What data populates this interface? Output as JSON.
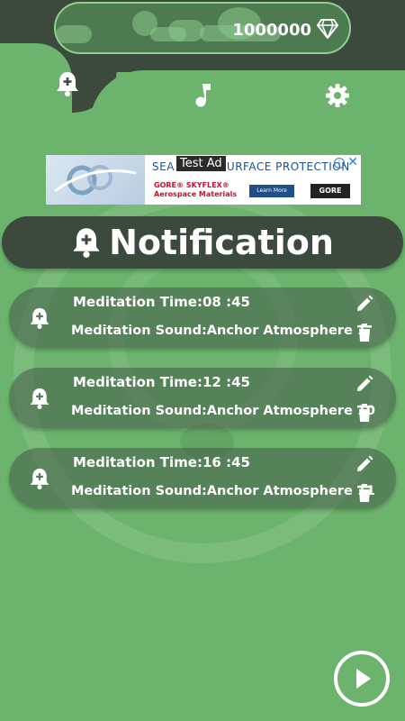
{
  "header": {
    "gem_count": "1000000",
    "tabs": [
      {
        "icon": "bell-plus-icon",
        "active": true
      },
      {
        "icon": "music-note-icon",
        "active": false
      },
      {
        "icon": "gear-icon",
        "active": false
      }
    ]
  },
  "ad": {
    "label": "Test Ad",
    "headline": "SEA",
    "headline_tail": "URFACE PROTECTION",
    "brand_line1": "GORE® SKYFLEX®",
    "brand_line2": "Aerospace Materials",
    "cta": "Learn More",
    "logo": "GORE"
  },
  "title": {
    "text": "Notification",
    "icon": "bell-plus-icon"
  },
  "notifications": [
    {
      "time_label": "Meditation Time:",
      "time": "08 :45",
      "sound_label": "Meditation Sound:",
      "sound": "Anchor Atmosphere 1"
    },
    {
      "time_label": "Meditation Time:",
      "time": "12 :45",
      "sound_label": "Meditation Sound:",
      "sound": "Anchor Atmosphere 10"
    },
    {
      "time_label": "Meditation Time:",
      "time": "16 :45",
      "sound_label": "Meditation Sound:",
      "sound": "Anchor Atmosphere 11"
    }
  ],
  "colors": {
    "background": "#6cb46d",
    "header": "#3c4a3e",
    "text": "#ffffff"
  }
}
